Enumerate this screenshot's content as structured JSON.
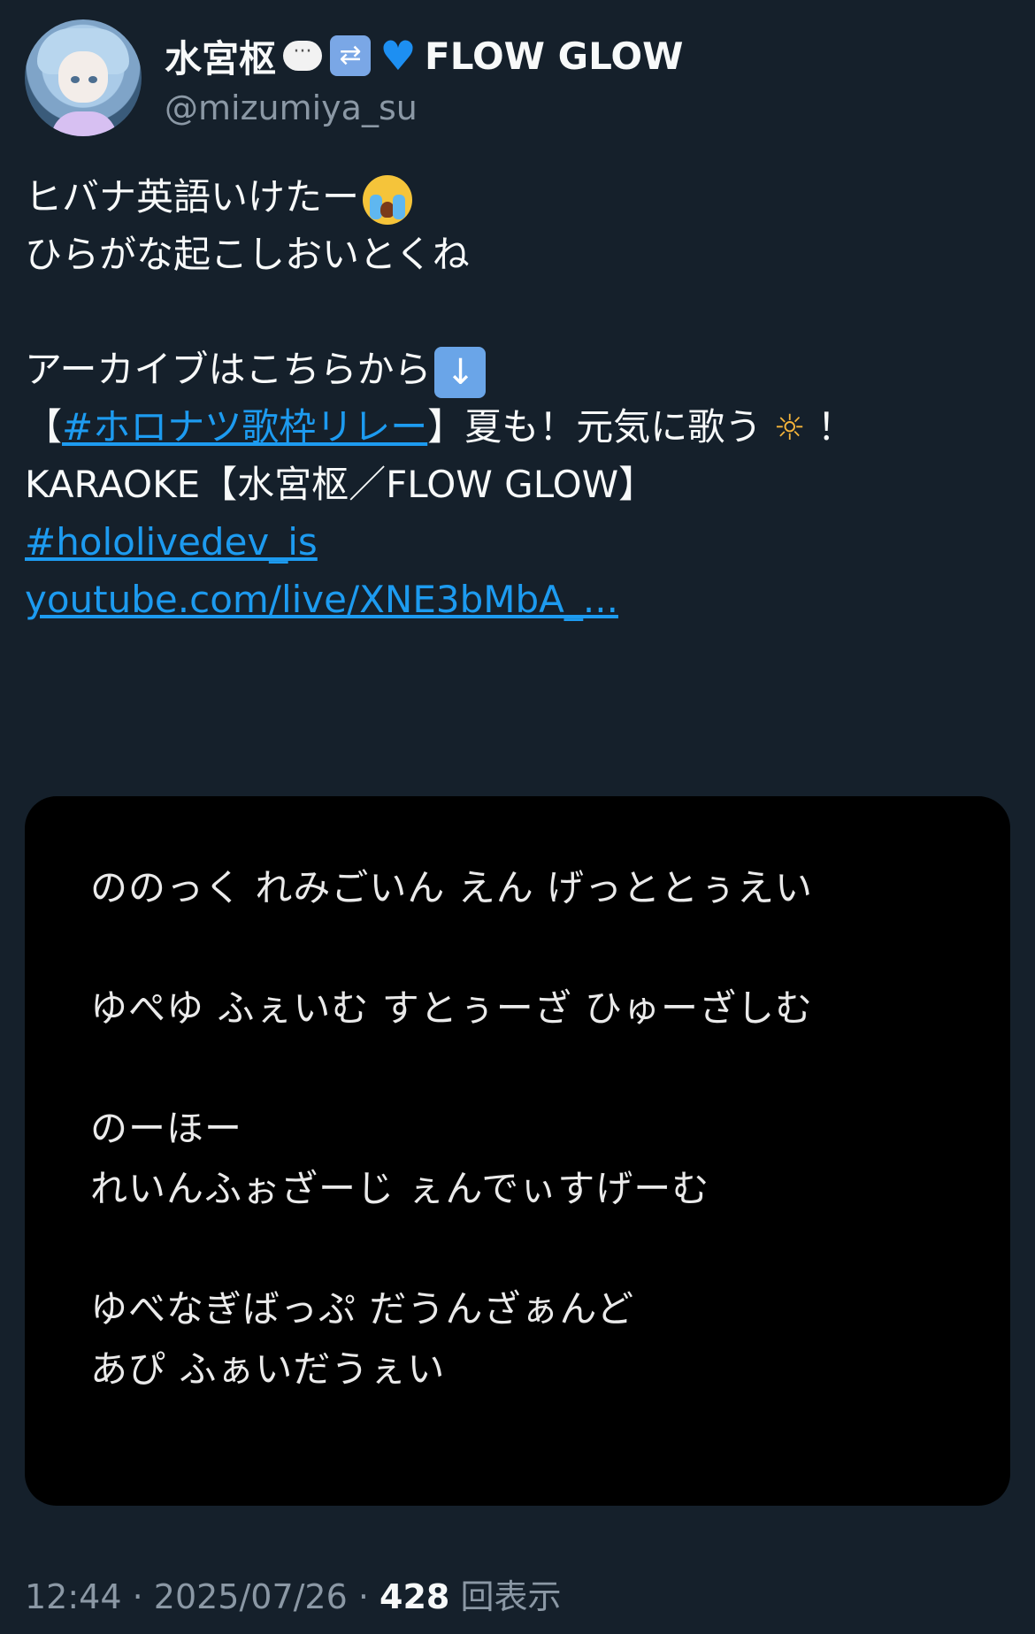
{
  "author": {
    "display_name": "水宮枢",
    "display_name_suffix": "FLOW GLOW",
    "handle": "@mizumiya_su",
    "name_badges": [
      "speech-bubble-icon",
      "repeat-icon",
      "blue-heart-icon"
    ]
  },
  "tweet": {
    "line1": "ヒバナ英語いけたー",
    "line1_emoji": "loudly-crying-face-icon",
    "line2": "ひらがな起こしおいとくね",
    "line3": "アーカイブはこちらから",
    "line3_emoji": "down-arrow-icon",
    "line4_open": "【",
    "line4_hashtag": "#ホロナツ歌枠リレー",
    "line4_rest": "】夏も！元気に歌う",
    "line4_sun": "☼",
    "line4_end": " ！",
    "line5": "KARAOKE【水宮枢／FLOW GLOW】",
    "hashtag2": "#hololivedev_is",
    "url": "youtube.com/live/XNE3bMbA_..."
  },
  "lyrics": [
    "ののっく れみごいん えん げっととぅえい",
    "ゆぺゆ ふぇいむ すとぅーざ ひゅーざしむ",
    "のーほー",
    "れいんふぉざーじ ぇんでぃすげーむ",
    "ゆべなぎばっぷ だうんざぁんど",
    " あぴ ふぁいだうぇい"
  ],
  "meta": {
    "time": "12:44",
    "separator": " · ",
    "date": "2025/07/26",
    "views_count": "428",
    "views_label": " 回表示"
  },
  "colors": {
    "background": "#15202b",
    "link": "#1d9bf0",
    "secondary_text": "#8b98a5",
    "card": "#000000"
  }
}
